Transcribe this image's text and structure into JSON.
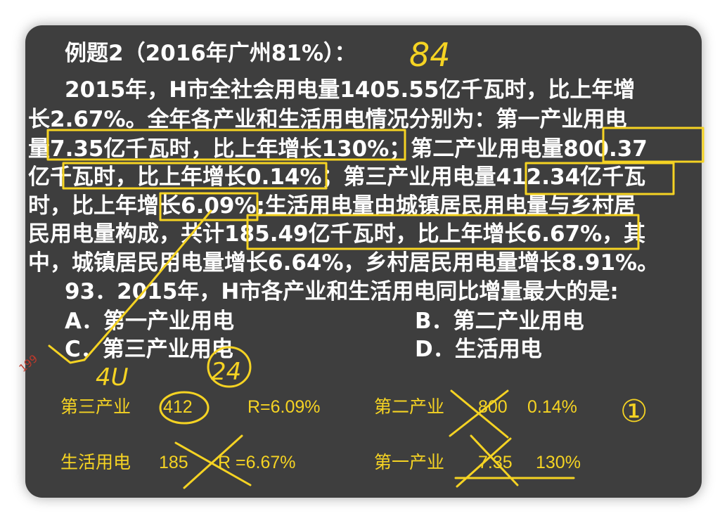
{
  "problem": {
    "title": "例题2（2016年广州81%）：",
    "lines": [
      "2015年，H市全社会用电量1405.55亿千瓦时，比上年增",
      "长2.67%。全年各产业和生活用电情况分别为：第一产业用电",
      "量7.35亿千瓦时，比上年增长130%；第二产业用电量800.37",
      "亿千瓦时，比上年增长0.14%；第三产业用电量412.34亿千瓦",
      "时，比上年增长6.09%;生活用电量由城镇居民用电量与乡村居",
      "民用电量构成，共计185.49亿千瓦时，比上年增长6.67%，其",
      "中，城镇居民用电量增长6.64%，乡村居民用电量增长8.91%。"
    ],
    "question": "93．2015年，H市各产业和生活用电同比增量最大的是:",
    "options": {
      "a": "A．第一产业用电",
      "b": "B．第二产业用电",
      "c": "C．第三产业用电",
      "d": "D．生活用电"
    }
  },
  "notes": {
    "third_label": "第三产业",
    "third_value": "412",
    "third_rate": "R=6.09%",
    "second_label": "第二产业",
    "second_value": "800",
    "second_rate": "0.14%",
    "life_label": "生活用电",
    "life_value": "185",
    "life_rate": "R =6.67%",
    "first_label": "第一产业",
    "first_value": "7.35",
    "first_rate": "130%"
  },
  "handwriting": {
    "top": "84",
    "under_c_1": "4U",
    "under_c_2": "24",
    "right_mark": "①"
  },
  "watermark": "199",
  "colors": {
    "board": "#3e3e3e",
    "text": "#ffffff",
    "ink": "#f5d323"
  }
}
